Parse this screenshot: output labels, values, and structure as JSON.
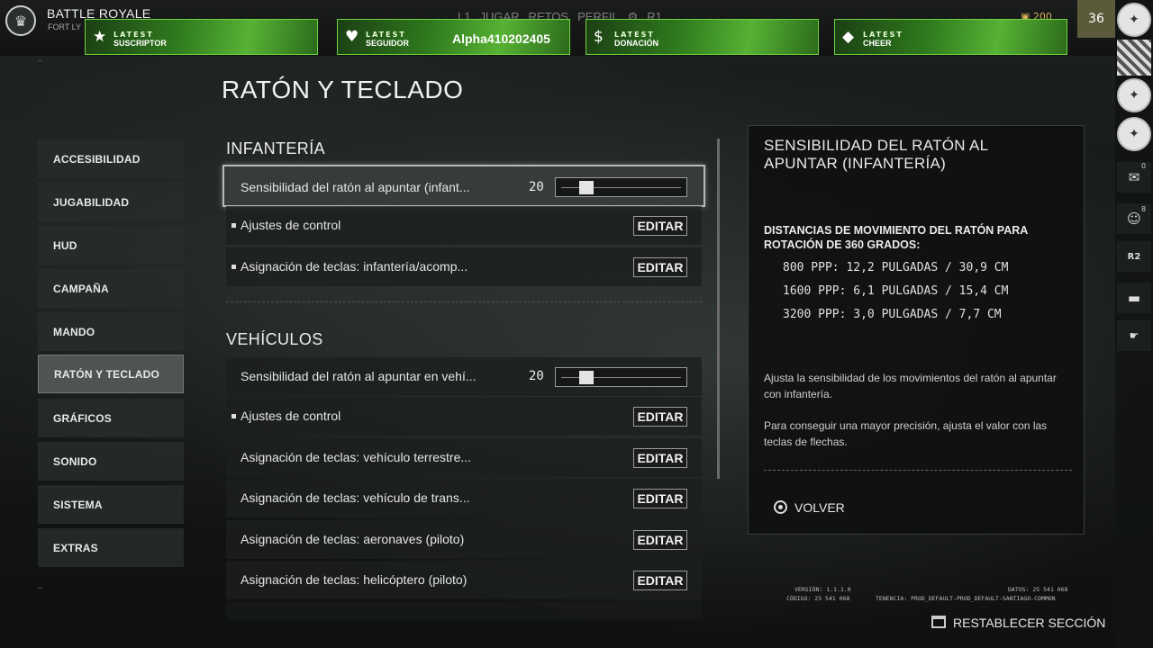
{
  "header": {
    "mode_title": "BATTLE ROYALE",
    "mode_sub": "FORT LY",
    "nav": [
      "L1",
      "JUGAR",
      "RETOS",
      "PERFIL",
      "R1"
    ],
    "credits": "200",
    "level": "36"
  },
  "alerts": [
    {
      "icon": "star-icon",
      "line1": "LATEST",
      "line2": "SUSCRIPTOR",
      "value": ""
    },
    {
      "icon": "heart-icon",
      "line1": "LATEST",
      "line2": "SEGUIDOR",
      "value": "Alpha410202405"
    },
    {
      "icon": "dollar-icon",
      "line1": "LATEST",
      "line2": "DONACIÓN",
      "value": ""
    },
    {
      "icon": "diamond-icon",
      "line1": "LATEST",
      "line2": "CHEER",
      "value": ""
    }
  ],
  "strip": {
    "mail_count": "0",
    "friends_count": "8",
    "r2_label": "R2"
  },
  "page_title": "RATÓN Y TECLADO",
  "menu": [
    "ACCESIBILIDAD",
    "JUGABILIDAD",
    "HUD",
    "CAMPAÑA",
    "MANDO",
    "RATÓN Y TECLADO",
    "GRÁFICOS",
    "SONIDO",
    "SISTEMA",
    "EXTRAS"
  ],
  "menu_active": "RATÓN Y TECLADO",
  "sections": {
    "infantry": {
      "title": "INFANTERÍA",
      "slider": {
        "label": "Sensibilidad del ratón al apuntar (infant...",
        "value": "20",
        "level": 0.2
      },
      "rows": [
        {
          "label": "Ajustes de control",
          "button": "EDITAR"
        },
        {
          "label": "Asignación de teclas: infantería/acomp...",
          "button": "EDITAR"
        }
      ]
    },
    "vehicles": {
      "title": "VEHÍCULOS",
      "slider": {
        "label": "Sensibilidad del ratón al apuntar en vehí...",
        "value": "20",
        "level": 0.2
      },
      "rows": [
        {
          "label": "Ajustes de control",
          "button": "EDITAR"
        },
        {
          "label": "Asignación de teclas: vehículo terrestre...",
          "button": "EDITAR"
        },
        {
          "label": "Asignación de teclas: vehículo de trans...",
          "button": "EDITAR"
        },
        {
          "label": "Asignación de teclas: aeronaves (piloto)",
          "button": "EDITAR"
        },
        {
          "label": "Asignación de teclas: helicóptero (piloto)",
          "button": "EDITAR"
        }
      ]
    }
  },
  "panel": {
    "title": "SENSIBILIDAD DEL RATÓN AL APUNTAR (INFANTERÍA)",
    "distance_heading": "DISTANCIAS DE MOVIMIENTO DEL RATÓN PARA ROTACIÓN DE 360 GRADOS:",
    "distances": [
      "800 PPP: 12,2 PULGADAS / 30,9 CM",
      "1600 PPP: 6,1 PULGADAS / 15,4 CM",
      "3200 PPP: 3,0 PULGADAS / 7,7 CM"
    ],
    "desc1": "Ajusta la sensibilidad de los movimientos del ratón al apuntar con infantería.",
    "desc2": "Para conseguir una mayor precisión, ajusta el valor con las teclas de flechas.",
    "back_label": "VOLVER"
  },
  "footer": {
    "version": "VERSIÓN: 1.1.1.0",
    "code": "CÓDIGO: 25 541 068",
    "data": "DATOS: 25 541 068",
    "tenancy": "TENENCIA: PROD_DEFAULT-PROD_DEFAULT-SANTIAGO-COMMON",
    "reset_label": "RESTABLECER SECCIÓN"
  }
}
